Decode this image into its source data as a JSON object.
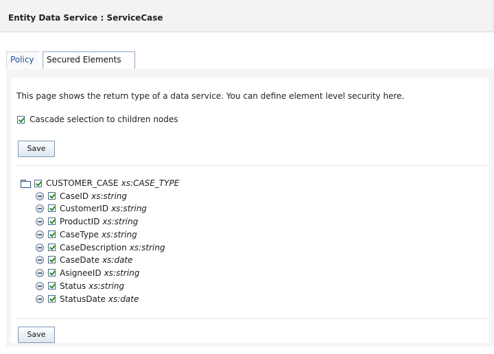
{
  "header": {
    "title": "Entity Data Service : ServiceCase"
  },
  "tabs": [
    {
      "label": "Policy",
      "selected": false
    },
    {
      "label": "Secured Elements",
      "selected": true
    }
  ],
  "content": {
    "description": "This page shows the return type of a data service. You can define element level security here.",
    "cascade": {
      "label": "Cascade selection to children nodes",
      "checked": true
    },
    "save_top_label": "Save",
    "save_bottom_label": "Save"
  },
  "tree": {
    "root": {
      "name": "CUSTOMER_CASE",
      "type": "xs:CASE_TYPE",
      "checked": true,
      "icon": "folder-icon"
    },
    "children": [
      {
        "name": "CaseID",
        "type": "xs:string",
        "checked": true
      },
      {
        "name": "CustomerID",
        "type": "xs:string",
        "checked": true
      },
      {
        "name": "ProductID",
        "type": "xs:string",
        "checked": true
      },
      {
        "name": "CaseType",
        "type": "xs:string",
        "checked": true
      },
      {
        "name": "CaseDescription",
        "type": "xs:string",
        "checked": true
      },
      {
        "name": "CaseDate",
        "type": "xs:date",
        "checked": true
      },
      {
        "name": "AsigneeID",
        "type": "xs:string",
        "checked": true
      },
      {
        "name": "Status",
        "type": "xs:string",
        "checked": true
      },
      {
        "name": "StatusDate",
        "type": "xs:date",
        "checked": true
      }
    ]
  },
  "colors": {
    "link": "#1f4f9e",
    "check": "#1e8a1e",
    "tab_border": "#8fa6bd"
  }
}
